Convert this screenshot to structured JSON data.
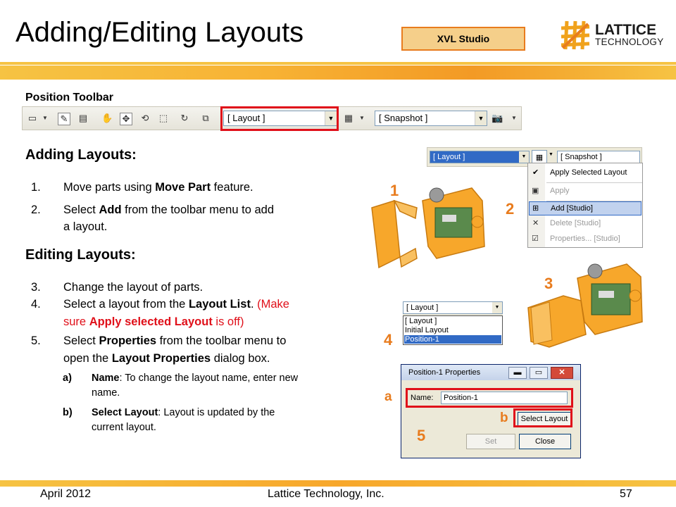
{
  "header": {
    "title": "Adding/Editing Layouts",
    "badge": "XVL Studio",
    "logo_main": "LATTICE",
    "logo_sub": "TECHNOLOGY"
  },
  "toolbar_section": {
    "label": "Position Toolbar",
    "layout_dropdown": "[ Layout ]",
    "snapshot_dropdown": "[ Snapshot ]"
  },
  "adding": {
    "heading": "Adding Layouts:",
    "steps": [
      {
        "num": "1.",
        "pre": "Move parts using ",
        "bold": "Move Part",
        "post": " feature."
      },
      {
        "num": "2.",
        "pre": "Select ",
        "bold": "Add",
        "post": " from the toolbar menu to add",
        "line2": "a layout."
      }
    ]
  },
  "editing": {
    "heading": "Editing Layouts:",
    "step3": {
      "num": "3.",
      "text": "Change the layout of parts."
    },
    "step4": {
      "num": "4.",
      "pre": "Select a layout from the ",
      "bold": "Layout List",
      "post": ". ",
      "red1": "(Make",
      "red2": "sure ",
      "red_bold": "Apply selected Layout",
      "red3": " is off)"
    },
    "step5": {
      "num": "5.",
      "pre": "Select ",
      "bold": "Properties",
      "post": " from the toolbar menu to",
      "line2_pre": "open the ",
      "line2_bold": "Layout Properties",
      "line2_post": " dialog box."
    },
    "sub_a": {
      "label": "a)",
      "bold": "Name",
      "text": ": To change the layout name, enter new",
      "line2": "name."
    },
    "sub_b": {
      "label": "b)",
      "bold": "Select Layout",
      "text": ": Layout is updated by the",
      "line2": "current layout."
    }
  },
  "menu_screenshot": {
    "layout_dd": "[ Layout ]",
    "snapshot_dd": "[ Snapshot ]",
    "items": [
      "Apply Selected Layout",
      "Apply",
      "Add [Studio]",
      "Delete [Studio]",
      "Properties... [Studio]"
    ]
  },
  "list_screenshot": {
    "dd": "[ Layout ]",
    "items": [
      "[ Layout ]",
      "Initial Layout",
      "Position-1"
    ]
  },
  "dialog": {
    "title": "Position-1 Properties",
    "name_label": "Name:",
    "name_value": "Position-1",
    "select_layout": "Select Layout",
    "set": "Set",
    "close": "Close"
  },
  "callouts": {
    "c1": "1",
    "c2": "2",
    "c3": "3",
    "c4": "4",
    "ca": "a",
    "cb": "b",
    "c5": "5"
  },
  "footer": {
    "date": "April 2012",
    "company": "Lattice Technology, Inc.",
    "page": "57"
  },
  "colors": {
    "orange": "#e87c1e",
    "yellow": "#f6c343",
    "red": "#e0101a",
    "part": "#f7a72b"
  }
}
